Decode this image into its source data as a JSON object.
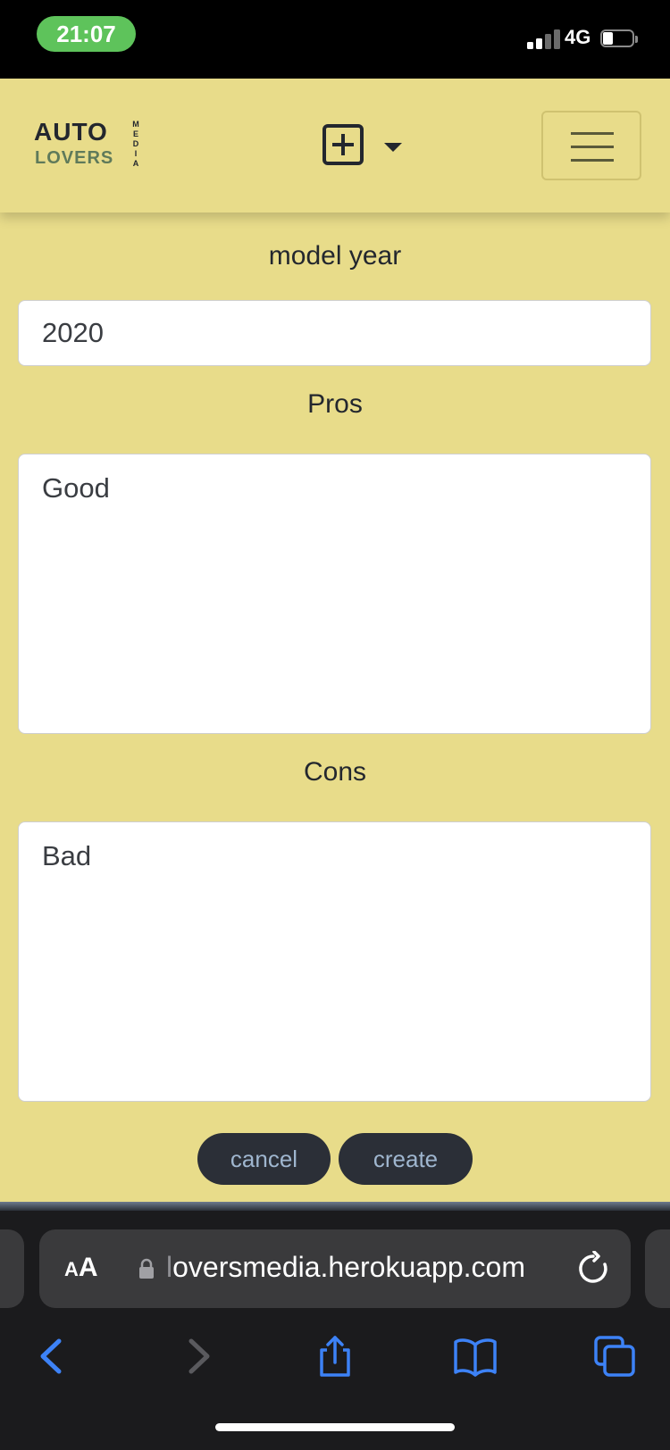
{
  "status_bar": {
    "time": "21:07",
    "network": "4G"
  },
  "logo": {
    "line1": "AUTO",
    "line2": "LOVERS",
    "side_text": "MEDIA"
  },
  "form": {
    "model_year": {
      "label": "model year",
      "value": "2020"
    },
    "pros": {
      "label": "Pros",
      "value": "Good"
    },
    "cons": {
      "label": "Cons",
      "value": "Bad"
    },
    "cancel_label": "cancel",
    "create_label": "create"
  },
  "browser": {
    "aa_small": "A",
    "aa_big": "A",
    "url_dim_prefix": "l",
    "url_rest": "oversmedia.herokuapp.com"
  },
  "colors": {
    "page_bg": "#e8dc8a",
    "button_bg": "#2b2f37",
    "button_text": "#9fb6cf",
    "safari_accent": "#3d82f6"
  }
}
